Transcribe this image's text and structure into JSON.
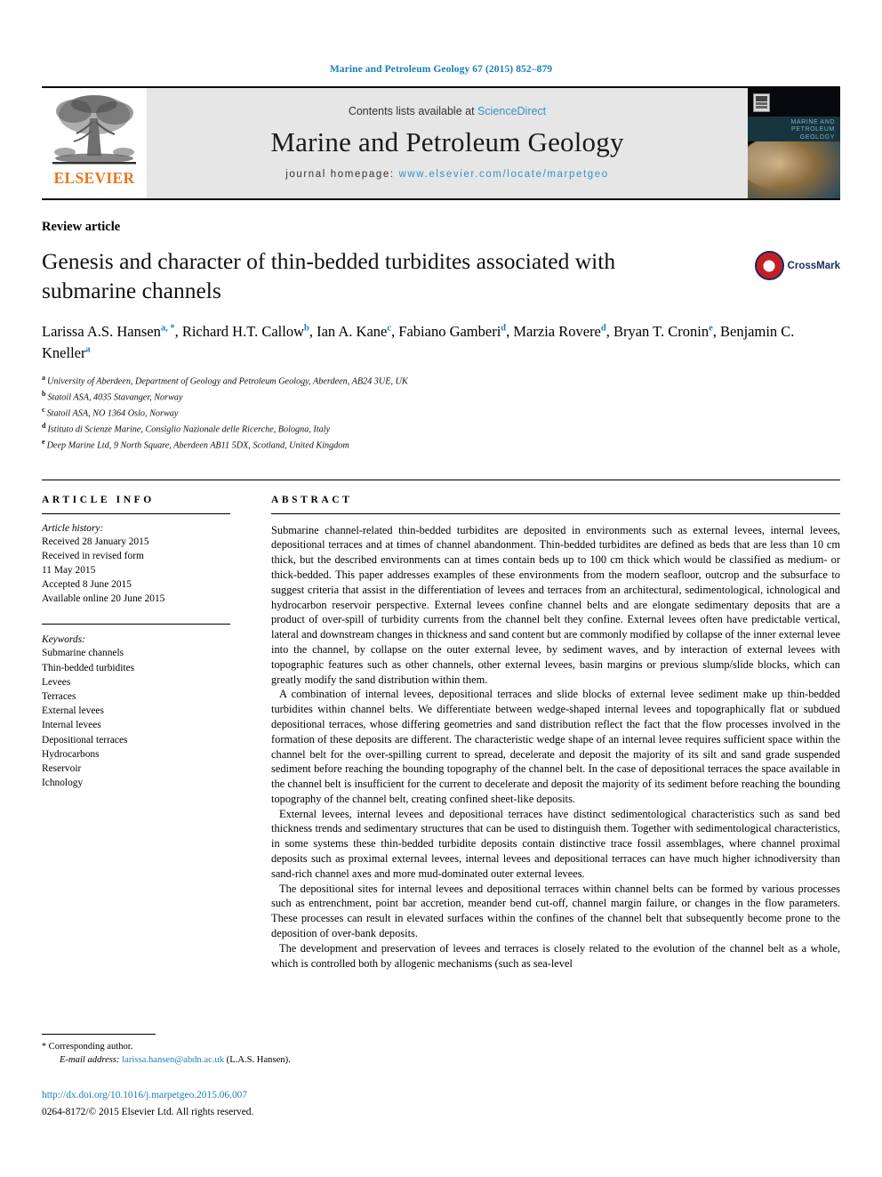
{
  "running_head": "Marine and Petroleum Geology 67 (2015) 852–879",
  "masthead": {
    "contents_prefix": "Contents lists available at",
    "sciencedirect": "ScienceDirect",
    "journal_name": "Marine and Petroleum Geology",
    "homepage_prefix": "journal homepage:",
    "homepage_url": "www.elsevier.com/locate/marpetgeo",
    "publisher": "ELSEVIER",
    "link_color": "#3a8fc4",
    "publisher_color": "#e87722"
  },
  "article": {
    "type": "Review article",
    "title": "Genesis and character of thin-bedded turbidites associated with submarine channels",
    "crossmark_label": "CrossMark",
    "authors_line_1": "Larissa A.S. Hansen ",
    "authors": [
      {
        "name": "Larissa A.S. Hansen",
        "marks": "a, *"
      },
      {
        "name": "Richard H.T. Callow",
        "marks": "b"
      },
      {
        "name": "Ian A. Kane",
        "marks": "c"
      },
      {
        "name": "Fabiano Gamberi",
        "marks": "d"
      },
      {
        "name": "Marzia Rovere",
        "marks": "d"
      },
      {
        "name": "Bryan T. Cronin",
        "marks": "e"
      },
      {
        "name": "Benjamin C. Kneller",
        "marks": "a"
      }
    ],
    "affiliations": [
      {
        "mark": "a",
        "text": "University of Aberdeen, Department of Geology and Petroleum Geology, Aberdeen, AB24 3UE, UK"
      },
      {
        "mark": "b",
        "text": "Statoil ASA, 4035 Stavanger, Norway"
      },
      {
        "mark": "c",
        "text": "Statoil ASA, NO 1364 Oslo, Norway"
      },
      {
        "mark": "d",
        "text": "Istituto di Scienze Marine, Consiglio Nazionale delle Ricerche, Bologna, Italy"
      },
      {
        "mark": "e",
        "text": "Deep Marine Ltd, 9 North Square, Aberdeen AB11 5DX, Scotland, United Kingdom"
      }
    ]
  },
  "info": {
    "heading": "ARTICLE INFO",
    "history_label": "Article history:",
    "history": [
      "Received 28 January 2015",
      "Received in revised form",
      "11 May 2015",
      "Accepted 8 June 2015",
      "Available online 20 June 2015"
    ],
    "keywords_label": "Keywords:",
    "keywords": [
      "Submarine channels",
      "Thin-bedded turbidites",
      "Levees",
      "Terraces",
      "External levees",
      "Internal levees",
      "Depositional terraces",
      "Hydrocarbons",
      "Reservoir",
      "Ichnology"
    ]
  },
  "abstract": {
    "heading": "ABSTRACT",
    "paragraphs": [
      "Submarine channel-related thin-bedded turbidites are deposited in environments such as external levees, internal levees, depositional terraces and at times of channel abandonment. Thin-bedded turbidites are defined as beds that are less than 10 cm thick, but the described environments can at times contain beds up to 100 cm thick which would be classified as medium- or thick-bedded. This paper addresses examples of these environments from the modern seafloor, outcrop and the subsurface to suggest criteria that assist in the differentiation of levees and terraces from an architectural, sedimentological, ichnological and hydrocarbon reservoir perspective. External levees confine channel belts and are elongate sedimentary deposits that are a product of over-spill of turbidity currents from the channel belt they confine. External levees often have predictable vertical, lateral and downstream changes in thickness and sand content but are commonly modified by collapse of the inner external levee into the channel, by collapse on the outer external levee, by sediment waves, and by interaction of external levees with topographic features such as other channels, other external levees, basin margins or previous slump/slide blocks, which can greatly modify the sand distribution within them.",
      "A combination of internal levees, depositional terraces and slide blocks of external levee sediment make up thin-bedded turbidites within channel belts. We differentiate between wedge-shaped internal levees and topographically flat or subdued depositional terraces, whose differing geometries and sand distribution reflect the fact that the flow processes involved in the formation of these deposits are different. The characteristic wedge shape of an internal levee requires sufficient space within the channel belt for the over-spilling current to spread, decelerate and deposit the majority of its silt and sand grade suspended sediment before reaching the bounding topography of the channel belt. In the case of depositional terraces the space available in the channel belt is insufficient for the current to decelerate and deposit the majority of its sediment before reaching the bounding topography of the channel belt, creating confined sheet-like deposits.",
      "External levees, internal levees and depositional terraces have distinct sedimentological characteristics such as sand bed thickness trends and sedimentary structures that can be used to distinguish them. Together with sedimentological characteristics, in some systems these thin-bedded turbidite deposits contain distinctive trace fossil assemblages, where channel proximal deposits such as proximal external levees, internal levees and depositional terraces can have much higher ichnodiversity than sand-rich channel axes and more mud-dominated outer external levees.",
      "The depositional sites for internal levees and depositional terraces within channel belts can be formed by various processes such as entrenchment, point bar accretion, meander bend cut-off, channel margin failure, or changes in the flow parameters. These processes can result in elevated surfaces within the confines of the channel belt that subsequently become prone to the deposition of over-bank deposits.",
      "The development and preservation of levees and terraces is closely related to the evolution of the channel belt as a whole, which is controlled both by allogenic mechanisms (such as sea-level"
    ]
  },
  "footer": {
    "corresponding_star": "*",
    "corresponding_label": "Corresponding author.",
    "email_label": "E-mail address:",
    "email_address": "larissa.hansen@abdn.ac.uk",
    "email_owner": "(L.A.S. Hansen).",
    "doi": "http://dx.doi.org/10.1016/j.marpetgeo.2015.06.007",
    "copyright": "0264-8172/© 2015 Elsevier Ltd. All rights reserved."
  }
}
